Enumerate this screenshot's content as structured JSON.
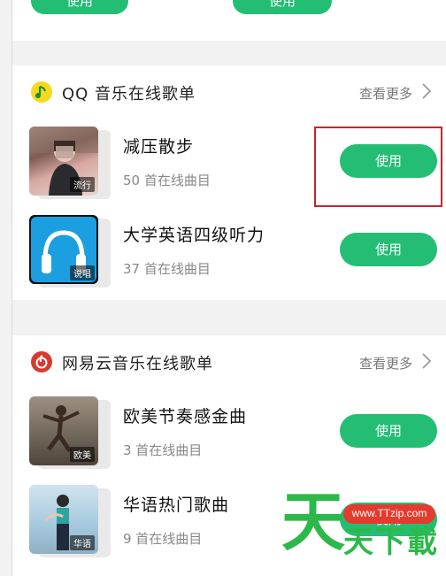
{
  "top": {
    "btn_left": "使用",
    "btn_right": "使用"
  },
  "qq_section": {
    "title": "QQ 音乐在线歌单",
    "more": "查看更多",
    "items": [
      {
        "title": "减压散步",
        "count": "50 首在线曲目",
        "tag": "流行",
        "button": "使用"
      },
      {
        "title": "大学英语四级听力",
        "count": "37 首在线曲目",
        "tag": "说唱",
        "button": "使用"
      }
    ]
  },
  "netease_section": {
    "title": "网易云音乐在线歌单",
    "more": "查看更多",
    "items": [
      {
        "title": "欧美节奏感金曲",
        "count": "3 首在线曲目",
        "tag": "欧美",
        "button": "使用"
      },
      {
        "title": "华语热门歌曲",
        "count": "9 首在线曲目",
        "tag": "华语",
        "button": "使用"
      }
    ]
  },
  "watermark": {
    "url": "www.TTzip.com",
    "big": "天",
    "small": "天下載"
  },
  "colors": {
    "accent": "#23be74",
    "highlight": "#c0272d",
    "qq_icon": "#f5d91e",
    "netease_icon": "#d83a2f"
  }
}
